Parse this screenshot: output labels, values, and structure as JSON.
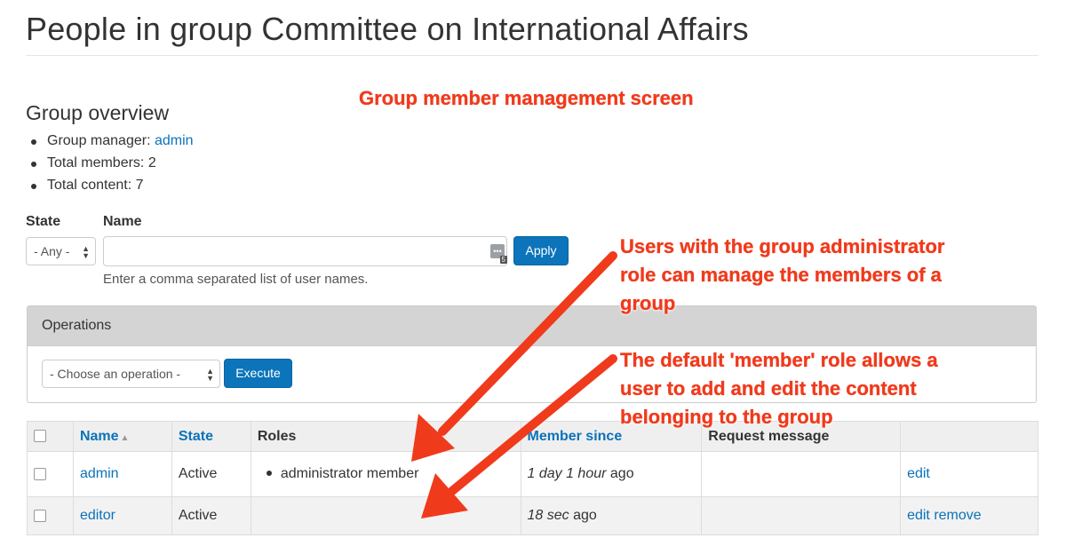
{
  "page": {
    "title": "People in group Committee on International Affairs"
  },
  "overview": {
    "heading": "Group overview",
    "manager_label": "Group manager: ",
    "manager_link": "admin",
    "total_members": "Total members: 2",
    "total_content": "Total content: 7"
  },
  "filters": {
    "state_label": "State",
    "state_value": "- Any -",
    "name_label": "Name",
    "name_value": "",
    "name_help": "Enter a comma separated list of user names.",
    "apply_label": "Apply",
    "extension_badge": "5"
  },
  "operations": {
    "title": "Operations",
    "select_value": "- Choose an operation -",
    "execute_label": "Execute"
  },
  "table": {
    "headers": {
      "name": "Name",
      "state": "State",
      "roles": "Roles",
      "member_since": "Member since",
      "request_message": "Request message"
    },
    "rows": [
      {
        "name": "admin",
        "state": "Active",
        "roles": "administrator member",
        "member_since_italic": "1 day 1 hour",
        "member_since_suffix": " ago",
        "request_message": "",
        "actions": [
          "edit"
        ]
      },
      {
        "name": "editor",
        "state": "Active",
        "roles": "",
        "member_since_italic": "18 sec",
        "member_since_suffix": " ago",
        "request_message": "",
        "actions": [
          "edit",
          "remove"
        ]
      }
    ]
  },
  "annotations": {
    "heading": "Group member management screen",
    "note1": [
      "Users with the group administrator",
      "role can manage the members of a",
      "group"
    ],
    "note2": [
      "The default 'member' role allows a",
      "user to add and edit the content",
      "belonging to the group"
    ]
  },
  "colors": {
    "link": "#0b72b9",
    "primary_button": "#0b74bb",
    "annotation": "#f03a1c",
    "panel_header": "#d4d4d4"
  },
  "icons": {
    "sort": "sort-ascending-icon",
    "select_arrows": "select-arrows-icon",
    "password_manager": "password-manager-icon"
  }
}
